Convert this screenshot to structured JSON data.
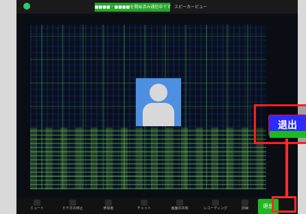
{
  "window": {
    "banner_text": "■■■■・■■■■を開始済み通信中です",
    "speaker_view_label": "スピーカービュー"
  },
  "toolbar": {
    "items": [
      {
        "label": "ミュート"
      },
      {
        "label": "ビデオの停止"
      },
      {
        "label": "参加者"
      },
      {
        "label": "チャット"
      },
      {
        "label": "画面の共有"
      },
      {
        "label": "レコーディング"
      },
      {
        "label": "詳細"
      }
    ],
    "end_label": "退出"
  },
  "popup": {
    "end_label": "退出"
  },
  "colors": {
    "accent_green": "#1fb81f",
    "avatar_blue": "#4d8fe0",
    "highlight_red": "#ff2b2b"
  },
  "icons": {
    "shield": "shield-icon",
    "user": "user-icon"
  }
}
